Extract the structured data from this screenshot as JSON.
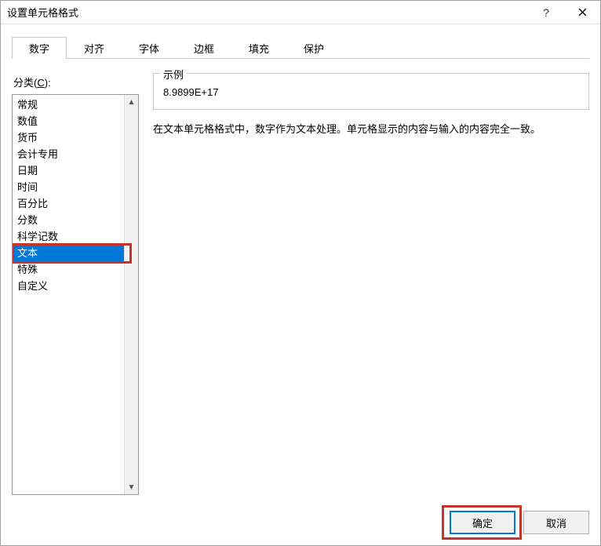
{
  "window": {
    "title": "设置单元格格式",
    "help_tooltip": "?",
    "close_tooltip": "×"
  },
  "tabs": [
    {
      "label": "数字",
      "active": true
    },
    {
      "label": "对齐",
      "active": false
    },
    {
      "label": "字体",
      "active": false
    },
    {
      "label": "边框",
      "active": false
    },
    {
      "label": "填充",
      "active": false
    },
    {
      "label": "保护",
      "active": false
    }
  ],
  "category": {
    "label_prefix": "分类(",
    "label_hotkey": "C",
    "label_suffix": "):",
    "items": [
      "常规",
      "数值",
      "货币",
      "会计专用",
      "日期",
      "时间",
      "百分比",
      "分数",
      "科学记数",
      "文本",
      "特殊",
      "自定义"
    ],
    "selected_index": 9
  },
  "right": {
    "example_legend": "示例",
    "example_value": "8.9899E+17",
    "description": "在文本单元格格式中，数字作为文本处理。单元格显示的内容与输入的内容完全一致。"
  },
  "buttons": {
    "ok": "确定",
    "cancel": "取消"
  },
  "colors": {
    "selection": "#0078d7",
    "highlight_border": "#c4342d"
  }
}
